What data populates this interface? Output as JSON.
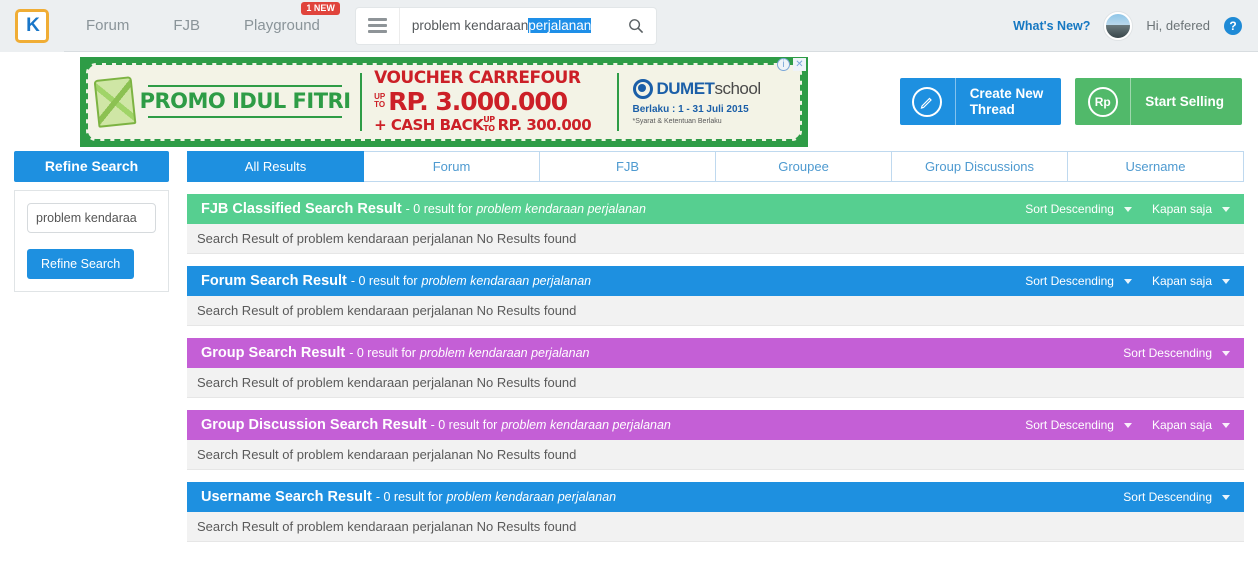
{
  "header": {
    "logo_text": "K",
    "logo_icon": "kaskus-logo-icon",
    "nav": [
      {
        "label": "Forum",
        "badge": null
      },
      {
        "label": "FJB",
        "badge": null
      },
      {
        "label": "Playground",
        "badge": "1 NEW"
      }
    ],
    "menu_icon": "hamburger-icon",
    "search": {
      "text_plain": "problem kendaraan ",
      "text_selected": "perjalanan",
      "full_value": "problem kendaraan perjalanan",
      "placeholder": "Search",
      "search_icon": "search-icon"
    },
    "whats_new": "What's New?",
    "avatar_icon": "user-avatar",
    "greeting": "Hi, defered",
    "help_icon": "?"
  },
  "ad": {
    "promo_title": "PROMO IDUL FITRI",
    "voucher_head": "VOUCHER CARREFOUR",
    "up_to_1": "UP\nTO",
    "amount": "RP. 3.000.000",
    "cashback_label": "+ CASH BACK",
    "cashback_amount": "RP. 300.000",
    "brand_name": "DUMET",
    "brand_suffix": "school",
    "validity": "Berlaku : 1 - 31 Juli 2015",
    "terms": "*Syarat & Ketentuan Berlaku",
    "info_icon": "i",
    "close_icon": "✕",
    "ketupat_icon": "ketupat-icon",
    "dumet_icon": "dumet-logo-icon"
  },
  "actions": {
    "create_thread": {
      "label_line1": "Create New",
      "label_line2": "Thread",
      "icon": "pencil-icon",
      "color": "#1e90e0"
    },
    "start_selling": {
      "label": "Start Selling",
      "icon": "Rp",
      "color": "#51b96a"
    }
  },
  "sidebar": {
    "title": "Refine Search",
    "input_value": "problem kendaraa",
    "input_placeholder": "Search keyword",
    "button_label": "Refine Search"
  },
  "tabs": [
    {
      "label": "All Results",
      "active": true
    },
    {
      "label": "Forum",
      "active": false
    },
    {
      "label": "FJB",
      "active": false
    },
    {
      "label": "Groupee",
      "active": false
    },
    {
      "label": "Group Discussions",
      "active": false
    },
    {
      "label": "Username",
      "active": false
    }
  ],
  "common": {
    "result_count_text": "- 0 result for",
    "search_term": "problem kendaraan perjalanan",
    "sort_label": "Sort Descending",
    "time_label": "Kapan saja",
    "caret_icon": "chevron-down-icon"
  },
  "sections": [
    {
      "title": "FJB Classified Search Result",
      "count_text": "- 0 result for",
      "term": "problem kendaraan perjalanan",
      "body": "Search Result of problem kendaraan perjalanan No Results found",
      "sort": "Sort Descending",
      "time": "Kapan saja",
      "color": "#56cf90"
    },
    {
      "title": "Forum Search Result",
      "count_text": "- 0 result for",
      "term": "problem kendaraan perjalanan",
      "body": "Search Result of problem kendaraan perjalanan No Results found",
      "sort": "Sort Descending",
      "time": "Kapan saja",
      "color": "#1e90e0"
    },
    {
      "title": "Group Search Result",
      "count_text": "- 0 result for",
      "term": "problem kendaraan perjalanan",
      "body": "Search Result of problem kendaraan perjalanan No Results found",
      "sort": "Sort Descending",
      "time": null,
      "color": "#c45fd6"
    },
    {
      "title": "Group Discussion Search Result",
      "count_text": "- 0 result for",
      "term": "problem kendaraan perjalanan",
      "body": "Search Result of problem kendaraan perjalanan No Results found",
      "sort": "Sort Descending",
      "time": "Kapan saja",
      "color": "#c45fd6"
    },
    {
      "title": "Username Search Result",
      "count_text": "- 0 result for",
      "term": "problem kendaraan perjalanan",
      "body": "Search Result of problem kendaraan perjalanan No Results found",
      "sort": "Sort Descending",
      "time": null,
      "color": "#1e90e0"
    }
  ]
}
